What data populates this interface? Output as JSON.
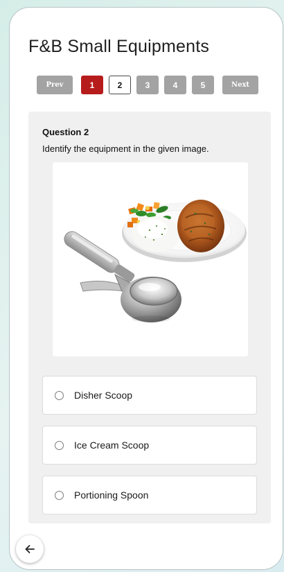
{
  "app": {
    "title": "F&B Small Equipments"
  },
  "pagination": {
    "prev_label": "Prev",
    "next_label": "Next",
    "pages": [
      "1",
      "2",
      "3",
      "4",
      "5"
    ],
    "answered_page": "1",
    "current_page": "2"
  },
  "question": {
    "number_label": "Question 2",
    "text": "Identify the equipment in the given image."
  },
  "options": [
    {
      "label": "Disher Scoop"
    },
    {
      "label": "Ice Cream Scoop"
    },
    {
      "label": "Portioning Spoon"
    }
  ],
  "navigation": {
    "back_icon": "arrow-left-icon"
  },
  "colors": {
    "answered": "#b71c1c",
    "inactive": "#a3a3a3",
    "card_background": "#f0f0f0"
  }
}
